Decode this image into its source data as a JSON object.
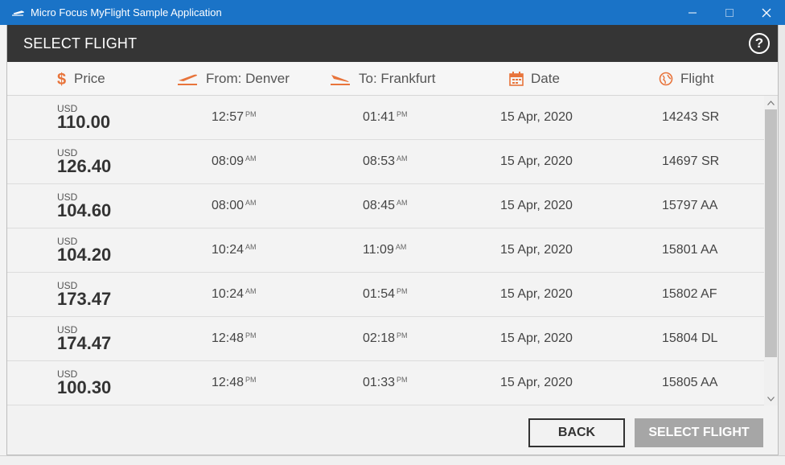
{
  "window": {
    "title": "Micro Focus MyFlight Sample Application"
  },
  "dialog": {
    "title": "SELECT FLIGHT",
    "help_label": "?"
  },
  "columns": {
    "price": "Price",
    "from": "From: Denver",
    "to": "To: Frankfurt",
    "date": "Date",
    "flight": "Flight"
  },
  "colors": {
    "accent": "#e8743b",
    "header_bg": "#353535",
    "titlebar_bg": "#1a73c7"
  },
  "rows": [
    {
      "currency": "USD",
      "price": "110.00",
      "dep_time": "12:57",
      "dep_ampm": "PM",
      "arr_time": "01:41",
      "arr_ampm": "PM",
      "date": "15 Apr, 2020",
      "flight": "14243 SR"
    },
    {
      "currency": "USD",
      "price": "126.40",
      "dep_time": "08:09",
      "dep_ampm": "AM",
      "arr_time": "08:53",
      "arr_ampm": "AM",
      "date": "15 Apr, 2020",
      "flight": "14697 SR"
    },
    {
      "currency": "USD",
      "price": "104.60",
      "dep_time": "08:00",
      "dep_ampm": "AM",
      "arr_time": "08:45",
      "arr_ampm": "AM",
      "date": "15 Apr, 2020",
      "flight": "15797 AA"
    },
    {
      "currency": "USD",
      "price": "104.20",
      "dep_time": "10:24",
      "dep_ampm": "AM",
      "arr_time": "11:09",
      "arr_ampm": "AM",
      "date": "15 Apr, 2020",
      "flight": "15801 AA"
    },
    {
      "currency": "USD",
      "price": "173.47",
      "dep_time": "10:24",
      "dep_ampm": "AM",
      "arr_time": "01:54",
      "arr_ampm": "PM",
      "date": "15 Apr, 2020",
      "flight": "15802 AF"
    },
    {
      "currency": "USD",
      "price": "174.47",
      "dep_time": "12:48",
      "dep_ampm": "PM",
      "arr_time": "02:18",
      "arr_ampm": "PM",
      "date": "15 Apr, 2020",
      "flight": "15804 DL"
    },
    {
      "currency": "USD",
      "price": "100.30",
      "dep_time": "12:48",
      "dep_ampm": "PM",
      "arr_time": "01:33",
      "arr_ampm": "PM",
      "date": "15 Apr, 2020",
      "flight": "15805 AA"
    }
  ],
  "footer": {
    "back_label": "BACK",
    "select_label": "SELECT FLIGHT"
  }
}
